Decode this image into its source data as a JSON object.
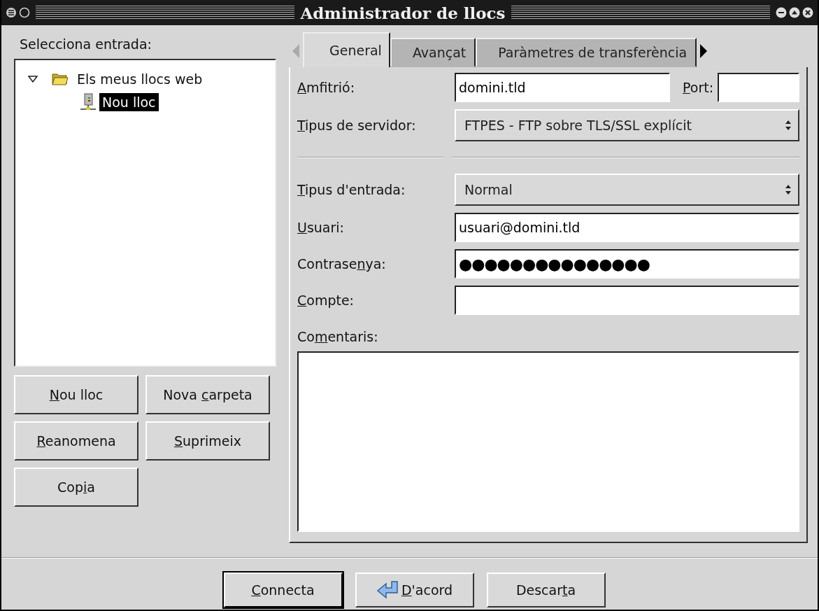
{
  "window": {
    "title": "Administrador de llocs"
  },
  "left": {
    "label": "Selecciona entrada:",
    "tree": [
      {
        "label": "Els meus llocs web",
        "kind": "folder",
        "expanded": true,
        "selected": false,
        "children": [
          {
            "label": "Nou lloc",
            "kind": "site",
            "selected": true
          }
        ]
      }
    ],
    "buttons": [
      {
        "key": "N",
        "post": "ou lloc"
      },
      {
        "pre": "Nova ",
        "key": "c",
        "post": "arpeta"
      },
      {
        "key": "R",
        "post": "eanomena"
      },
      {
        "key": "S",
        "post": "uprimeix"
      },
      {
        "pre": "Cop",
        "key": "i",
        "post": "a"
      }
    ]
  },
  "tabs": [
    {
      "label": "General",
      "selected": true
    },
    {
      "label": "Avançat",
      "selected": false
    },
    {
      "label": "Paràmetres de transferència",
      "selected": false
    }
  ],
  "form": {
    "host": {
      "label": {
        "key": "A",
        "post": "mfitrió:"
      },
      "value": "domini.tld"
    },
    "port": {
      "label": {
        "key": "P",
        "post": "ort:"
      }
    },
    "server_type": {
      "label": {
        "key": "T",
        "post": "ipus de servidor:"
      },
      "value": "FTPES - FTP sobre TLS/SSL explícit"
    },
    "logon_type": {
      "label": {
        "key": "T",
        "post": "ipus d'entrada:"
      },
      "value": "Normal"
    },
    "user": {
      "label": {
        "key": "U",
        "post": "suari:"
      },
      "value": "usuari@domini.tld"
    },
    "password": {
      "label": {
        "pre": "Contrase",
        "key": "n",
        "post": "ya:"
      },
      "value": "●●●●●●●●●●●●●●●"
    },
    "account": {
      "label": {
        "key": "C",
        "post": "ompte:"
      }
    },
    "comments": {
      "label": {
        "pre": "Co",
        "key": "m",
        "post": "entaris:"
      }
    }
  },
  "buttons": [
    {
      "key": "C",
      "post": "onnecta",
      "kind": "default"
    },
    {
      "key": "D",
      "post": "'acord",
      "kind": "ok"
    },
    {
      "pre": "Descar",
      "key": "t",
      "post": "a",
      "kind": "plain"
    }
  ]
}
